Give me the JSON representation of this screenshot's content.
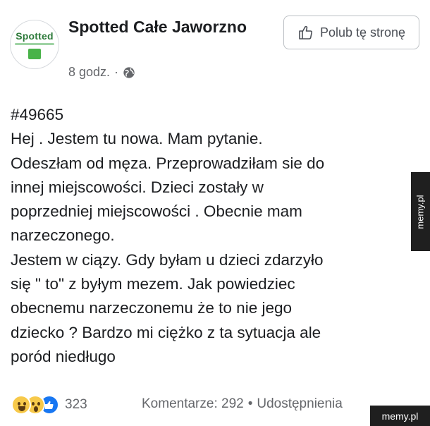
{
  "page": {
    "name": "Spotted Całe Jaworzno",
    "avatar_text": "Spotted",
    "time": "8 godz.",
    "separator": "·"
  },
  "like_button": {
    "label": "Polub tę stronę",
    "icon": "thumbs-up-icon"
  },
  "post": {
    "text": "#49665\nHej . Jestem tu nowa. Mam pytanie.\nOdeszłam od męza.  Przeprowadziłam sie do\ninnej miejscowości.  Dzieci zostały w\npoprzedniej miejscowości . Obecnie  mam\nnarzeczonego.\nJestem w ciązy. Gdy byłam u dzieci zdarzyło\nsię \" to\" z byłym mezem. Jak powiedziec\nobecnemu narzeczonemu że to nie jego\ndziecko  ? Bardzo mi ciężko z ta sytuacja ale\nporód niedługo"
  },
  "footer": {
    "reaction_icons": [
      "haha-icon",
      "wow-icon",
      "like-icon"
    ],
    "reaction_count": "323",
    "comments": "Komentarze: 292",
    "dot": "•",
    "shares": "Udostępnienia"
  },
  "watermarks": {
    "side": "memy.pl",
    "bottom": "memy.pl"
  },
  "colors": {
    "text": "#1c1e21",
    "secondary": "#65676b",
    "like_blue": "#1877f2",
    "watermark_bg": "#1f1f1f"
  }
}
